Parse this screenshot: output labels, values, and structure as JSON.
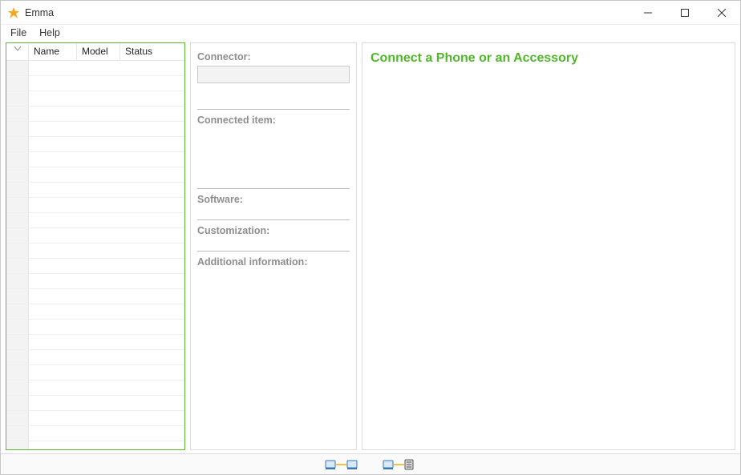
{
  "app": {
    "title": "Emma"
  },
  "menubar": {
    "file": "File",
    "help": "Help"
  },
  "left_panel": {
    "columns": {
      "c0": "",
      "c1": "Name",
      "c2": "Model",
      "c3": "Status"
    },
    "row_count": 26
  },
  "mid_panel": {
    "connector_label": "Connector:",
    "connector_value": "",
    "connected_item_label": "Connected item:",
    "software_label": "Software:",
    "customization_label": "Customization:",
    "additional_info_label": "Additional information:"
  },
  "right_panel": {
    "headline": "Connect a Phone or an Accessory"
  },
  "status": {
    "icon1": "connection-phone-icon",
    "icon2": "connection-server-icon"
  }
}
